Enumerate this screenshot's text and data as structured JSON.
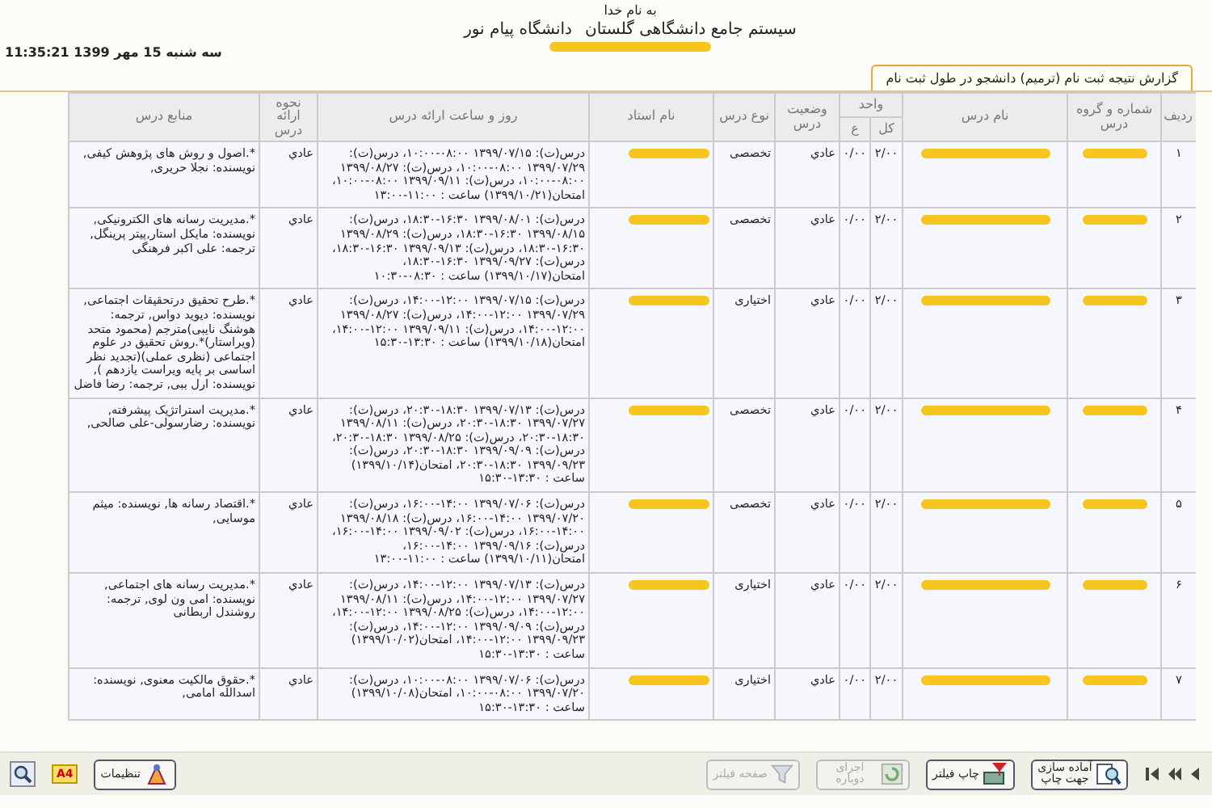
{
  "header": {
    "greeting": "به نام خدا",
    "system_title": "سیستم جامع دانشگاهی گلستان",
    "university": "دانشگاه پیام نور",
    "subtitle_redacted": true,
    "datetime": "11:35:21 سه شنبه 15 مهر 1399"
  },
  "tabs": [
    {
      "label": "گزارش نتیجه ثبت نام (ترمیم) دانشجو در طول ثبت نام",
      "selected": true
    }
  ],
  "table": {
    "columns": [
      "ردیف",
      "شماره و گروه درس",
      "نام درس",
      "واحد",
      "وضعیت درس",
      "نوع درس",
      "نام استاد",
      "روز و ساعت ارائه درس",
      "نحوه ارائه درس",
      "منابع درس"
    ],
    "unit_subcolumns": [
      "کل",
      "ع"
    ],
    "rows": [
      {
        "row": "۱",
        "code_redacted": true,
        "name_redacted": true,
        "total": "۲/۰۰",
        "practical": "۰/۰۰",
        "status": "عادي",
        "type": "تخصصی",
        "teacher_redacted": true,
        "schedule": "درس(ت): ۱۳۹۹/۰۷/۱۵ ۰۸:۰۰-۱۰:۰۰، درس(ت): ۱۳۹۹/۰۷/۲۹ ۰۸:۰۰-۱۰:۰۰، درس(ت): ۱۳۹۹/۰۸/۲۷ ۰۸:۰۰-۱۰:۰۰، درس(ت): ۱۳۹۹/۰۹/۱۱ ۰۸:۰۰-۱۰:۰۰، امتحان(۱۳۹۹/۱۰/۲۱) ساعت : ۱۱:۰۰-۱۳:۰۰",
        "delivery": "عادي",
        "sources": "*.اصول و روش های پژوهش کیفی, نویسنده: نجلا حریری,"
      },
      {
        "row": "۲",
        "code_redacted": true,
        "name_redacted": true,
        "total": "۲/۰۰",
        "practical": "۰/۰۰",
        "status": "عادي",
        "type": "تخصصی",
        "teacher_redacted": true,
        "schedule": "درس(ت): ۱۳۹۹/۰۸/۰۱ ۱۶:۳۰-۱۸:۳۰، درس(ت): ۱۳۹۹/۰۸/۱۵ ۱۶:۳۰-۱۸:۳۰، درس(ت): ۱۳۹۹/۰۸/۲۹ ۱۶:۳۰-۱۸:۳۰، درس(ت): ۱۳۹۹/۰۹/۱۳ ۱۶:۳۰-۱۸:۳۰، درس(ت): ۱۳۹۹/۰۹/۲۷ ۱۶:۳۰-۱۸:۳۰، امتحان(۱۳۹۹/۱۰/۱۷) ساعت : ۰۸:۳۰-۱۰:۳۰",
        "delivery": "عادي",
        "sources": "*.مدیریت رسانه های الکترونیکی, نویسنده: مایکل استار,پیتر پرینگل, ترجمه: علی اکبر فرهنگی"
      },
      {
        "row": "۳",
        "code_redacted": true,
        "name_redacted": true,
        "total": "۲/۰۰",
        "practical": "۰/۰۰",
        "status": "عادي",
        "type": "اختیاری",
        "teacher_redacted": true,
        "schedule": "درس(ت): ۱۳۹۹/۰۷/۱۵ ۱۲:۰۰-۱۴:۰۰، درس(ت): ۱۳۹۹/۰۷/۲۹ ۱۲:۰۰-۱۴:۰۰، درس(ت): ۱۳۹۹/۰۸/۲۷ ۱۲:۰۰-۱۴:۰۰، درس(ت): ۱۳۹۹/۰۹/۱۱ ۱۲:۰۰-۱۴:۰۰، امتحان(۱۳۹۹/۱۰/۱۸) ساعت : ۱۳:۳۰-۱۵:۳۰",
        "delivery": "عادي",
        "sources": "*.طرح تحقیق درتحقیقات اجتماعی, نویسنده: دیوید دواس, ترجمه: هوشنگ نایبی)مترجم (محمود متحد (ویراستار)*.روش تحقیق در علوم اجتماعی (نظری عملی)(تجدید نظر اساسی بر پایه ویراست یازدهم ), نویسنده: ارل ببی, ترجمه: رضا فاضل"
      },
      {
        "row": "۴",
        "code_redacted": true,
        "name_redacted": true,
        "total": "۲/۰۰",
        "practical": "۰/۰۰",
        "status": "عادي",
        "type": "تخصصی",
        "teacher_redacted": true,
        "schedule": "درس(ت): ۱۳۹۹/۰۷/۱۳ ۱۸:۳۰-۲۰:۳۰، درس(ت): ۱۳۹۹/۰۷/۲۷ ۱۸:۳۰-۲۰:۳۰، درس(ت): ۱۳۹۹/۰۸/۱۱ ۱۸:۳۰-۲۰:۳۰، درس(ت): ۱۳۹۹/۰۸/۲۵ ۱۸:۳۰-۲۰:۳۰، درس(ت): ۱۳۹۹/۰۹/۰۹ ۱۸:۳۰-۲۰:۳۰، درس(ت): ۱۳۹۹/۰۹/۲۳ ۱۸:۳۰-۲۰:۳۰، امتحان(۱۳۹۹/۱۰/۱۴) ساعت : ۱۳:۳۰-۱۵:۳۰",
        "delivery": "عادي",
        "sources": "*.مدیریت استراتژیک پیشرفته, نویسنده: رضارسولی-علی صالحی,"
      },
      {
        "row": "۵",
        "code_redacted": true,
        "name_redacted": true,
        "total": "۲/۰۰",
        "practical": "۰/۰۰",
        "status": "عادي",
        "type": "تخصصی",
        "teacher_redacted": true,
        "schedule": "درس(ت): ۱۳۹۹/۰۷/۰۶ ۱۴:۰۰-۱۶:۰۰، درس(ت): ۱۳۹۹/۰۷/۲۰ ۱۴:۰۰-۱۶:۰۰، درس(ت): ۱۳۹۹/۰۸/۱۸ ۱۴:۰۰-۱۶:۰۰، درس(ت): ۱۳۹۹/۰۹/۰۲ ۱۴:۰۰-۱۶:۰۰، درس(ت): ۱۳۹۹/۰۹/۱۶ ۱۴:۰۰-۱۶:۰۰، امتحان(۱۳۹۹/۱۰/۱۱) ساعت : ۱۱:۰۰-۱۳:۰۰",
        "delivery": "عادي",
        "sources": "*.اقتصاد رسانه ها, نویسنده: میثم موسایی,"
      },
      {
        "row": "۶",
        "code_redacted": true,
        "name_redacted": true,
        "total": "۲/۰۰",
        "practical": "۰/۰۰",
        "status": "عادي",
        "type": "اختیاری",
        "teacher_redacted": true,
        "schedule": "درس(ت): ۱۳۹۹/۰۷/۱۳ ۱۲:۰۰-۱۴:۰۰، درس(ت): ۱۳۹۹/۰۷/۲۷ ۱۲:۰۰-۱۴:۰۰، درس(ت): ۱۳۹۹/۰۸/۱۱ ۱۲:۰۰-۱۴:۰۰، درس(ت): ۱۳۹۹/۰۸/۲۵ ۱۲:۰۰-۱۴:۰۰، درس(ت): ۱۳۹۹/۰۹/۰۹ ۱۲:۰۰-۱۴:۰۰، درس(ت): ۱۳۹۹/۰۹/۲۳ ۱۲:۰۰-۱۴:۰۰، امتحان(۱۳۹۹/۱۰/۰۲) ساعت : ۱۳:۳۰-۱۵:۳۰",
        "delivery": "عادي",
        "sources": "*.مدیریت رسانه های اجتماعی, نویسنده: امی ون لوی, ترجمه: روشندل اربطانی"
      },
      {
        "row": "۷",
        "code_redacted": true,
        "name_redacted": true,
        "total": "۲/۰۰",
        "practical": "۰/۰۰",
        "status": "عادي",
        "type": "اختیاری",
        "teacher_redacted": true,
        "schedule": "درس(ت): ۱۳۹۹/۰۷/۰۶ ۰۸:۰۰-۱۰:۰۰، درس(ت): ۱۳۹۹/۰۷/۲۰ ۰۸:۰۰-۱۰:۰۰، امتحان(۱۳۹۹/۱۰/۰۸) ساعت : ۱۳:۳۰-۱۵:۳۰",
        "delivery": "عادي",
        "sources": "*.حقوق مالکیت معنوی, نویسنده: اسدالله امامی,"
      }
    ]
  },
  "toolbar": {
    "buttons": [
      {
        "label": "آماده سازی جهت چاپ",
        "kind": "print-preview",
        "disabled": false
      },
      {
        "label": "چاپ فیلتر",
        "kind": "print-filter",
        "disabled": false
      },
      {
        "label": "اجرای دوباره",
        "kind": "rerun",
        "disabled": true
      },
      {
        "label": "صفحه فیلتر",
        "kind": "filter",
        "disabled": true
      },
      {
        "label": "تنظیمات",
        "kind": "settings",
        "disabled": false
      }
    ],
    "page_size": "A4"
  }
}
